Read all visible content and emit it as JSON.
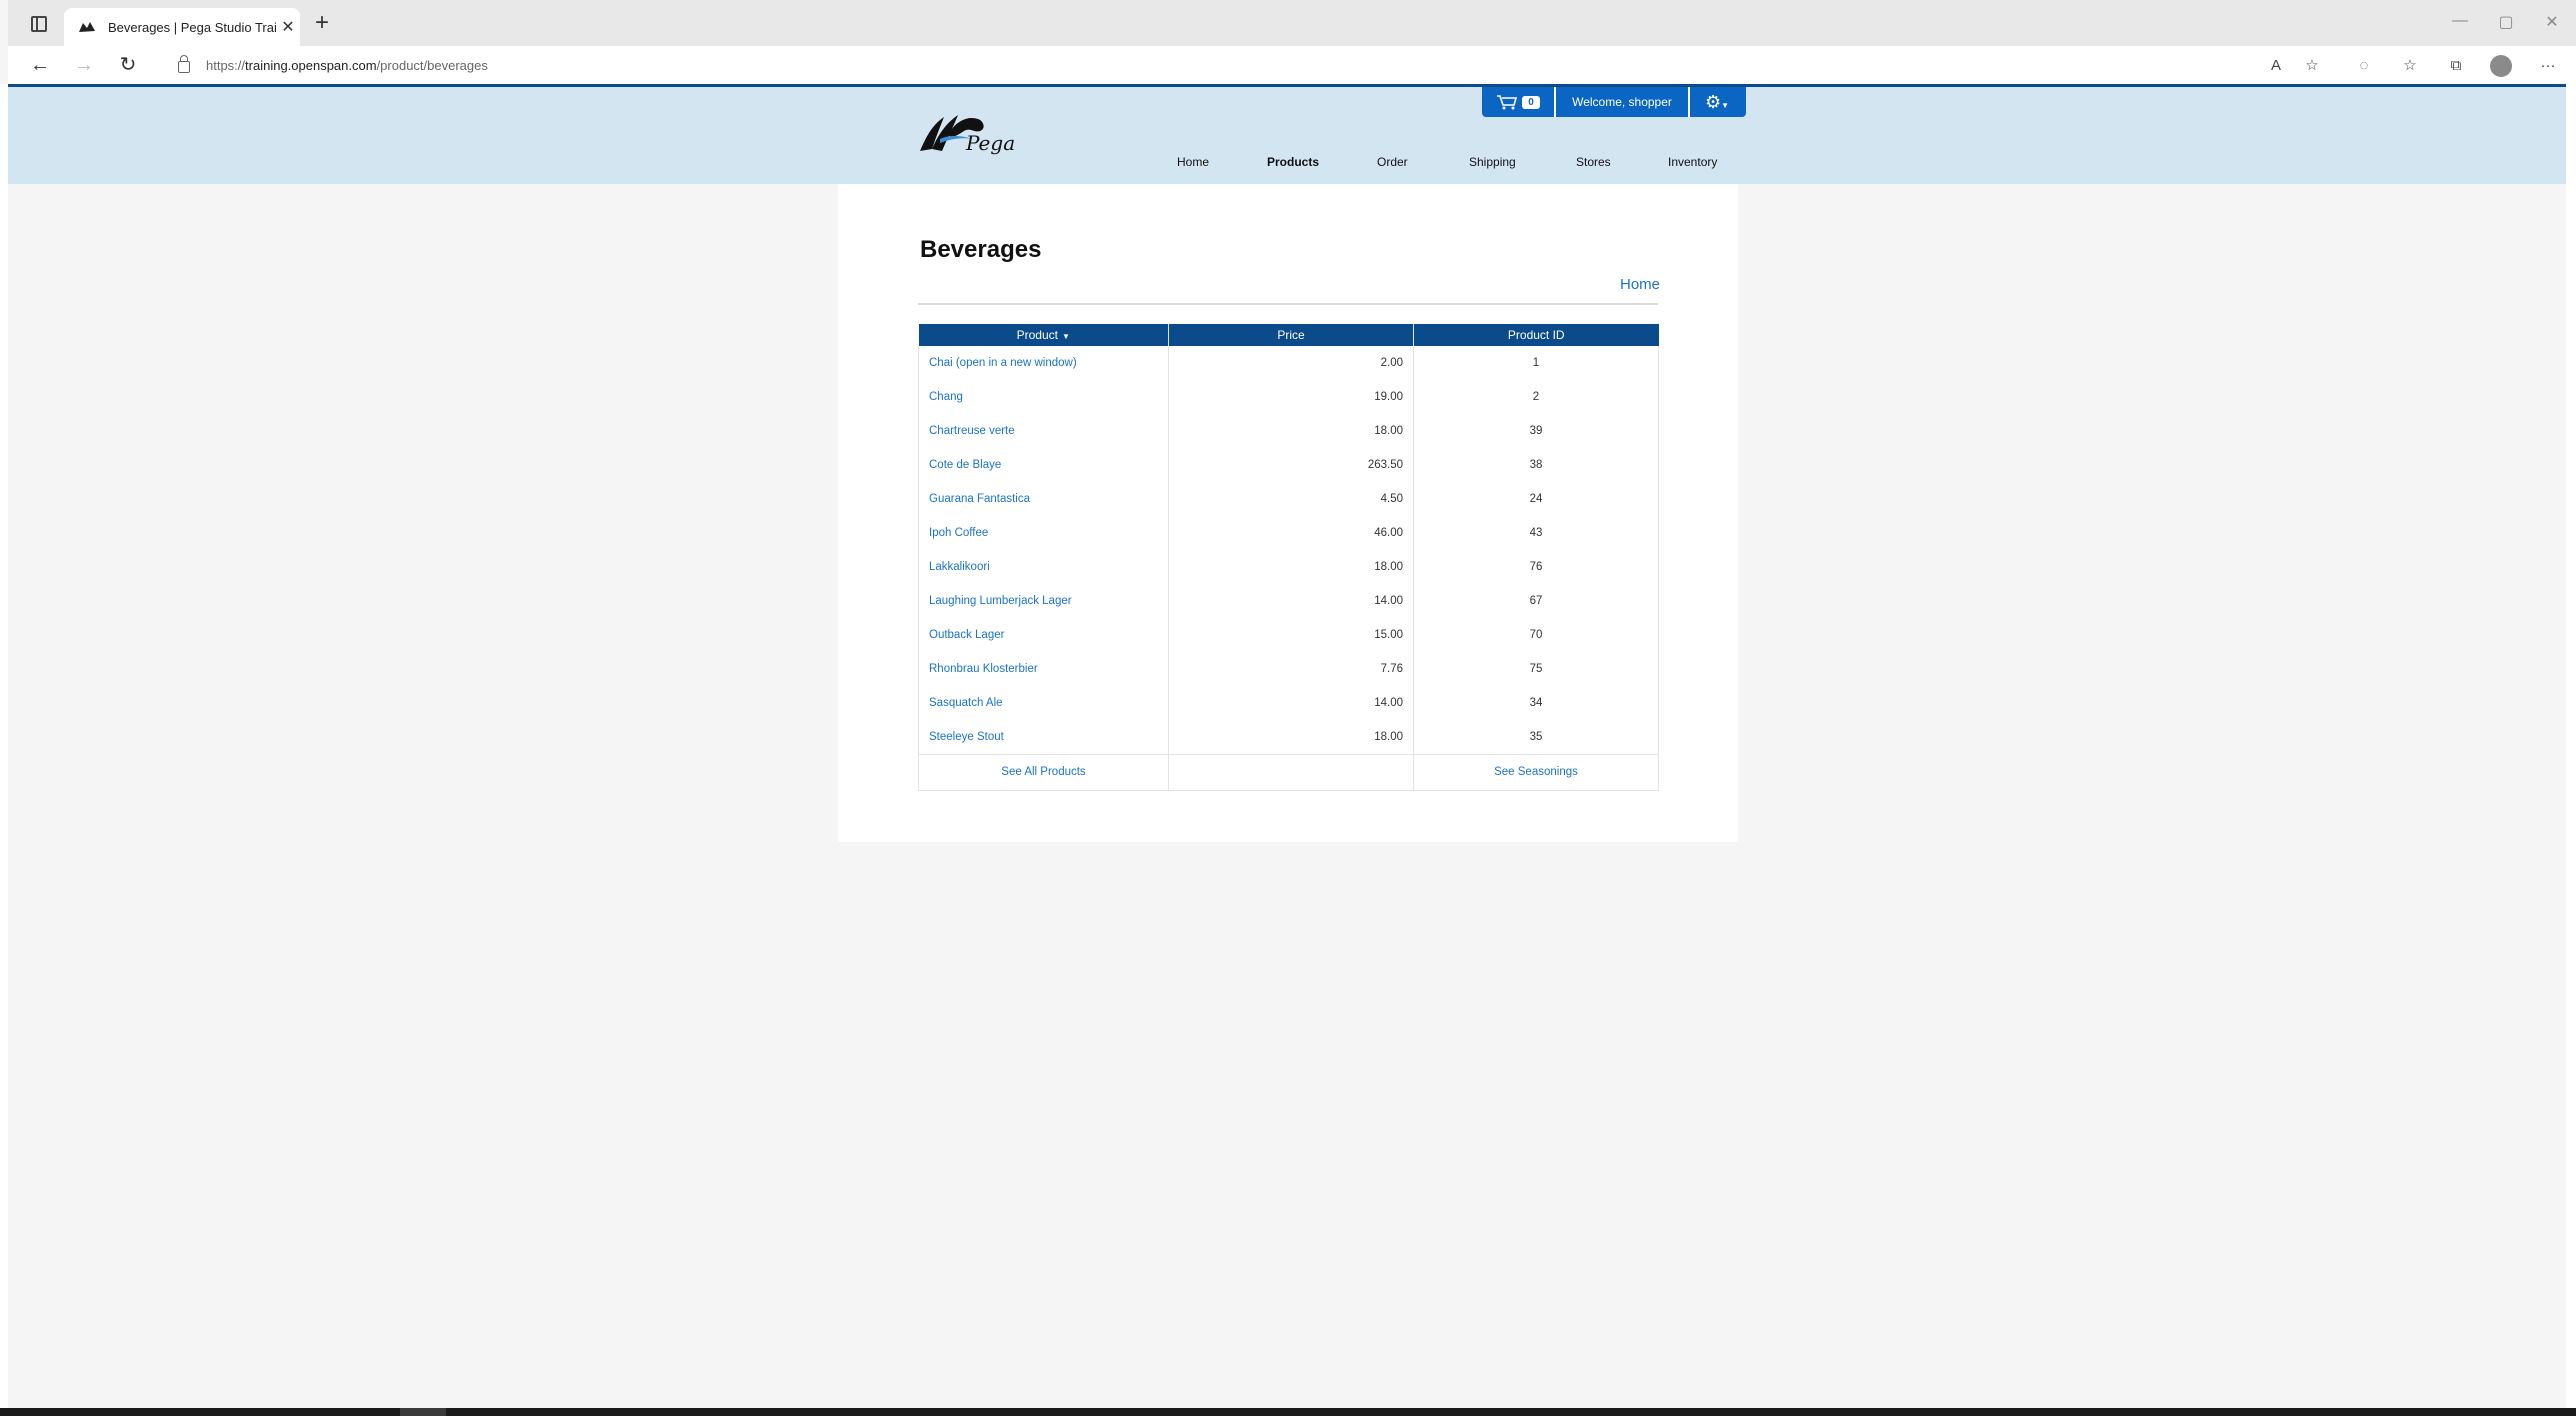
{
  "browser": {
    "tab_title": "Beverages | Pega Studio Training",
    "tab_close": "✕",
    "new_tab": "+",
    "url_scheme": "https://",
    "url_host": "training.openspan.com",
    "url_path": "/product/beverages",
    "window_controls": [
      "—",
      "▢",
      "✕"
    ]
  },
  "site": {
    "logo_text": "Pega",
    "cart_count": "0",
    "welcome": "Welcome, shopper",
    "nav": [
      "Home",
      "Products",
      "Order",
      "Shipping",
      "Stores",
      "Inventory"
    ],
    "active_nav": "Products"
  },
  "main": {
    "title": "Beverages",
    "home_link": "Home",
    "columns": [
      "Product",
      "Price",
      "Product ID"
    ],
    "rows": [
      {
        "name": "Chai  (open in a new window)",
        "price": "2.00",
        "id": "1"
      },
      {
        "name": "Chang",
        "price": "19.00",
        "id": "2"
      },
      {
        "name": "Chartreuse verte",
        "price": "18.00",
        "id": "39"
      },
      {
        "name": "Cote de Blaye",
        "price": "263.50",
        "id": "38"
      },
      {
        "name": "Guarana Fantastica",
        "price": "4.50",
        "id": "24"
      },
      {
        "name": "Ipoh Coffee",
        "price": "46.00",
        "id": "43"
      },
      {
        "name": "Lakkalikoori",
        "price": "18.00",
        "id": "76"
      },
      {
        "name": "Laughing Lumberjack Lager",
        "price": "14.00",
        "id": "67"
      },
      {
        "name": "Outback Lager",
        "price": "15.00",
        "id": "70"
      },
      {
        "name": "Rhonbrau Klosterbier",
        "price": "7.76",
        "id": "75"
      },
      {
        "name": "Sasquatch Ale",
        "price": "14.00",
        "id": "34"
      },
      {
        "name": "Steeleye Stout",
        "price": "18.00",
        "id": "35"
      }
    ],
    "footer_left": "See All Products",
    "footer_right": "See Seasonings"
  },
  "colors": {
    "header_bg": "#d4e5f2",
    "brand_blue": "#0b4a8b",
    "link_blue": "#1a73c9",
    "userbar_blue": "#0a66c2"
  }
}
